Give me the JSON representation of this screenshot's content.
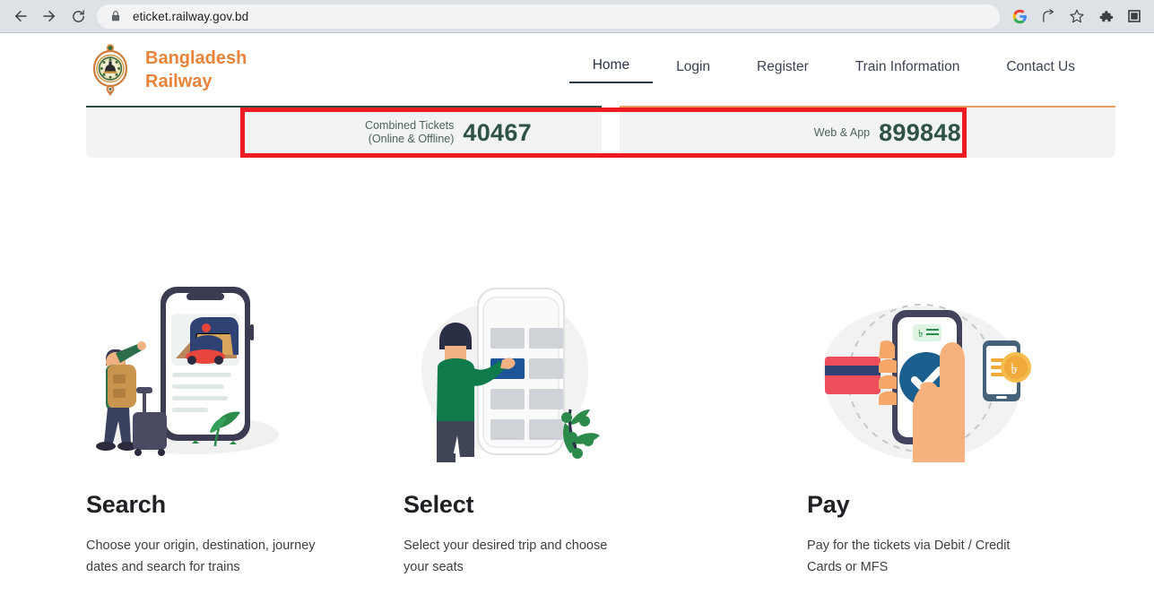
{
  "browser": {
    "url": "eticket.railway.gov.bd",
    "back_label": "Back",
    "forward_label": "Forward",
    "reload_label": "Reload",
    "lock_label": "Site information",
    "google_label": "Google",
    "share_label": "Share",
    "bookmark_label": "Bookmark this tab",
    "extensions_label": "Extensions",
    "profile_label": "Profile"
  },
  "site": {
    "brand_line1": "Bangladesh",
    "brand_line2": "Railway",
    "brand_color": "#e8833a",
    "nav": [
      {
        "label": "Home",
        "active": true
      },
      {
        "label": "Login",
        "active": false
      },
      {
        "label": "Register",
        "active": false
      },
      {
        "label": "Train Information",
        "active": false
      },
      {
        "label": "Contact Us",
        "active": false
      }
    ]
  },
  "counters": {
    "highlight_color": "#ed1c24",
    "value_color": "#2f5245",
    "left": {
      "label_line1": "Combined Tickets",
      "label_line2": "(Online & Offline)",
      "value": "40467"
    },
    "right": {
      "label_line1": "Web & App",
      "label_line2": "",
      "value": "899848"
    }
  },
  "features": [
    {
      "title": "Search",
      "desc": "Choose your origin, destination, journey dates and search for trains",
      "art": "search-illustration"
    },
    {
      "title": "Select",
      "desc": "Select your desired trip and choose your seats",
      "art": "select-illustration"
    },
    {
      "title": "Pay",
      "desc": "Pay for the tickets via Debit / Credit Cards or MFS",
      "art": "pay-illustration"
    }
  ]
}
